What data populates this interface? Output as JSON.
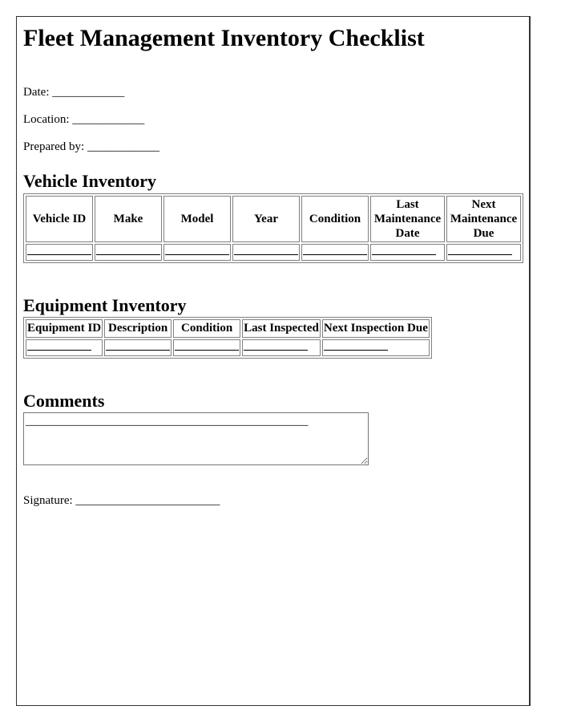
{
  "document": {
    "title": "Fleet Management Inventory Checklist",
    "fields": [
      {
        "label": "Date:",
        "blank": "____________"
      },
      {
        "label": "Location:",
        "blank": "____________"
      },
      {
        "label": "Prepared by:",
        "blank": "____________"
      }
    ],
    "vehicle_inventory": {
      "heading": "Vehicle Inventory",
      "columns": [
        "Vehicle ID",
        "Make",
        "Model",
        "Year",
        "Condition",
        "Last Maintenance Date",
        "Next Maintenance Due"
      ],
      "rows": [
        [
          "",
          "",
          "",
          "",
          "",
          "",
          ""
        ]
      ]
    },
    "equipment_inventory": {
      "heading": "Equipment Inventory",
      "columns": [
        "Equipment ID",
        "Description",
        "Condition",
        "Last Inspected",
        "Next Inspection Due"
      ],
      "rows": [
        [
          "",
          "",
          "",
          "",
          ""
        ]
      ]
    },
    "comments": {
      "heading": "Comments",
      "value": "_______________________________________________"
    },
    "signature": {
      "label": "Signature:",
      "blank": "________________________"
    }
  }
}
